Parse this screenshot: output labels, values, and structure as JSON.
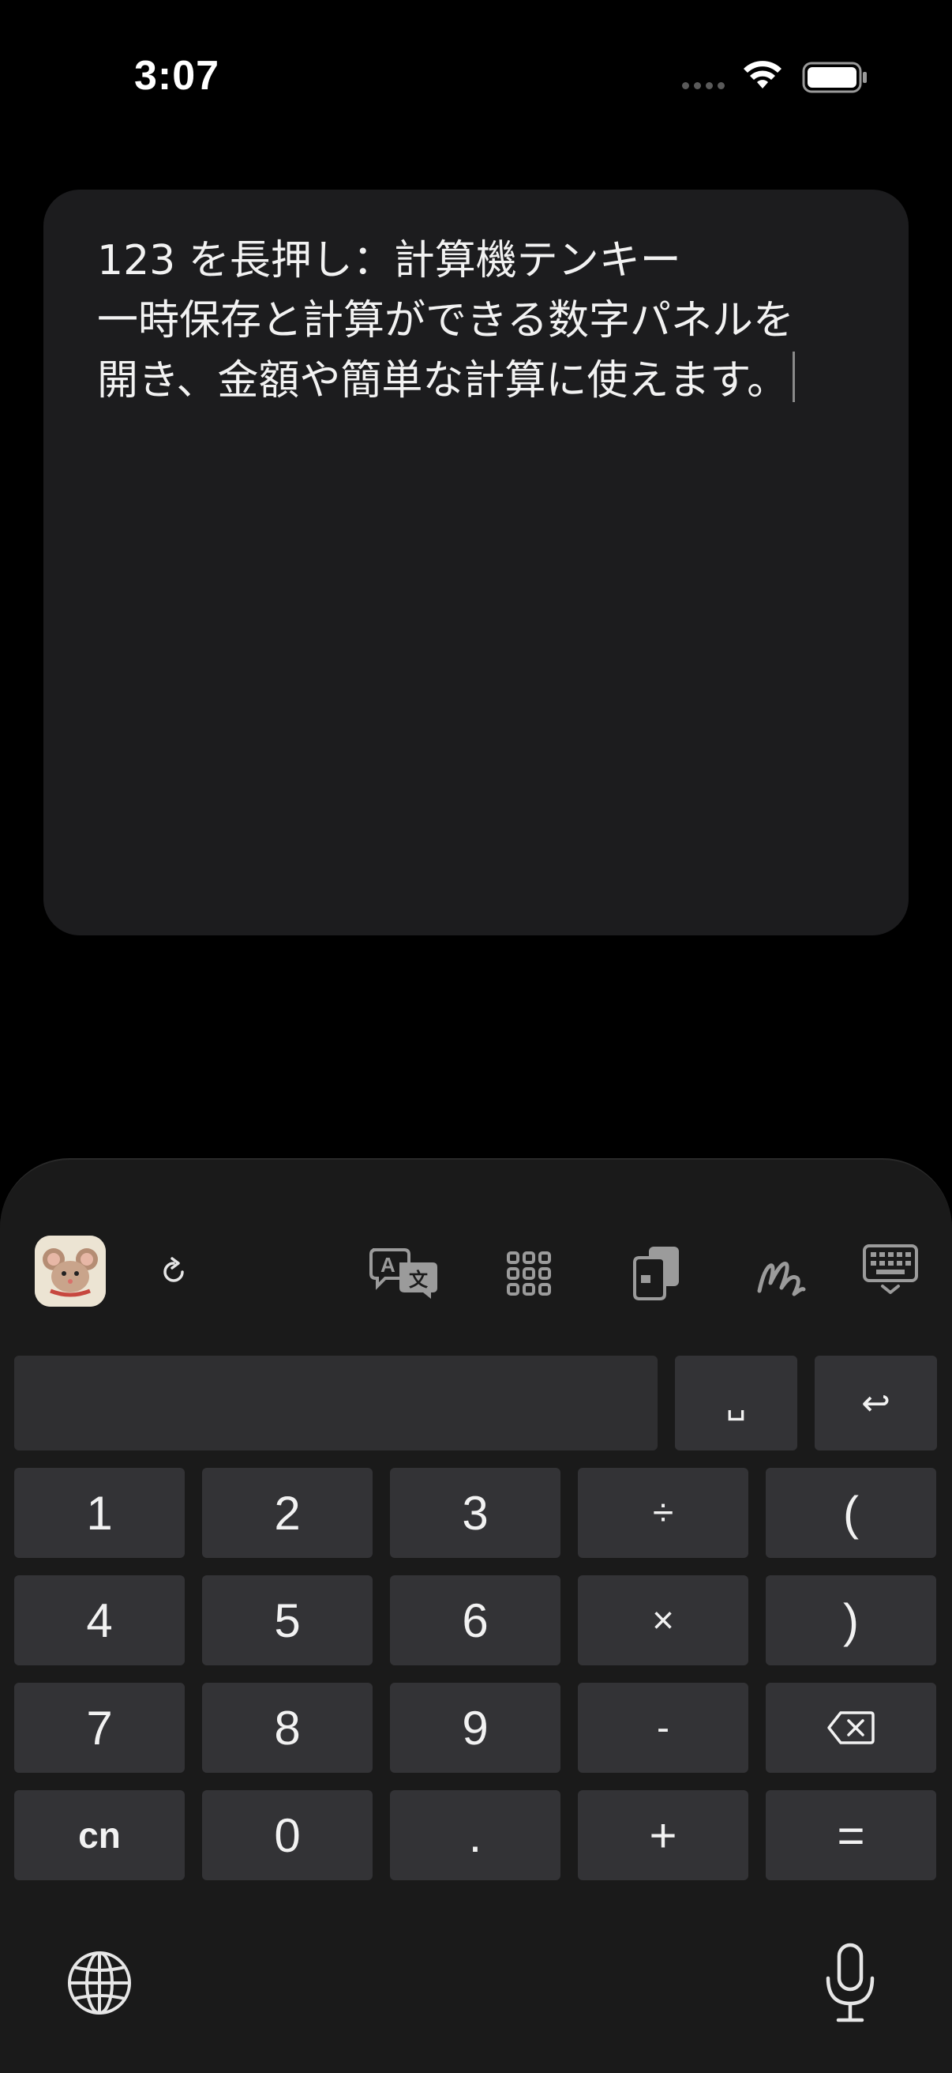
{
  "status_bar": {
    "time": "3:07"
  },
  "note": {
    "lines": [
      "123 を長押し：計算機テンキー",
      "一時保存と計算ができる数字パネルを",
      "開き、金額や簡単な計算に使えます。"
    ]
  },
  "keyboard": {
    "toolbar": {
      "icons": [
        "mouse-avatar-icon",
        "refresh-icon",
        "translate-icon",
        "grid-icon",
        "clipboard-icon",
        "handwriting-icon",
        "keyboard-dismiss-icon"
      ]
    },
    "input_value": "",
    "space_label": "␣",
    "return_label": "↩",
    "keys": {
      "k1": "1",
      "k2": "2",
      "k3": "3",
      "div": "÷",
      "lparen": "(",
      "k4": "4",
      "k5": "5",
      "k6": "6",
      "mul": "×",
      "rparen": ")",
      "k7": "7",
      "k8": "8",
      "k9": "9",
      "minus": "-",
      "cn": "cn",
      "k0": "0",
      "dot": ".",
      "plus": "+",
      "equals": "="
    },
    "bottom_icons": [
      "globe-icon",
      "microphone-icon"
    ]
  }
}
